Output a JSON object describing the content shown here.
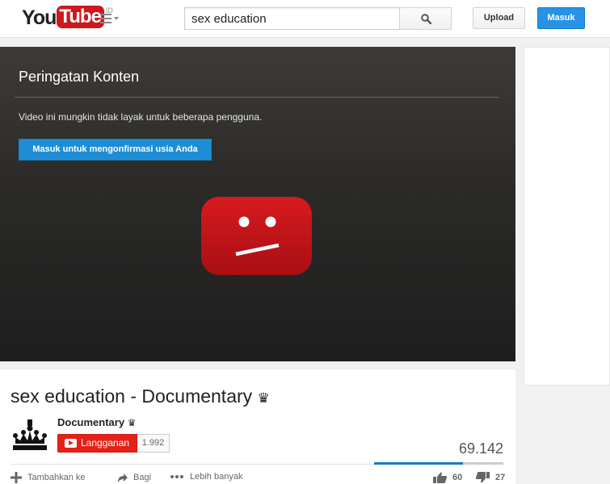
{
  "masthead": {
    "logo_you": "You",
    "logo_tube": "Tube",
    "logo_country": "ID",
    "search_value": "sex education",
    "upload_label": "Upload",
    "signin_label": "Masuk"
  },
  "player": {
    "warning_title": "Peringatan Konten",
    "warning_text": "Video ini mungkin tidak layak untuk beberapa pengguna.",
    "confirm_label": "Masuk untuk mengonfirmasi usia Anda"
  },
  "video": {
    "title": "sex education - Documentary",
    "title_glyph": "♛",
    "channel_name": "Documentary",
    "channel_glyph": "♛",
    "subscribe_label": "Langganan",
    "subscriber_count": "1.992",
    "view_count": "69.142",
    "like_ratio": 0.69
  },
  "actions": {
    "add_label": "Tambahkan ke",
    "share_label": "Bagi",
    "more_label": "Lebih banyak",
    "likes": "60",
    "dislikes": "27"
  },
  "colors": {
    "brand_red": "#cc181e",
    "accent_blue": "#1f8dd6",
    "subscribe_red": "#e62117"
  }
}
